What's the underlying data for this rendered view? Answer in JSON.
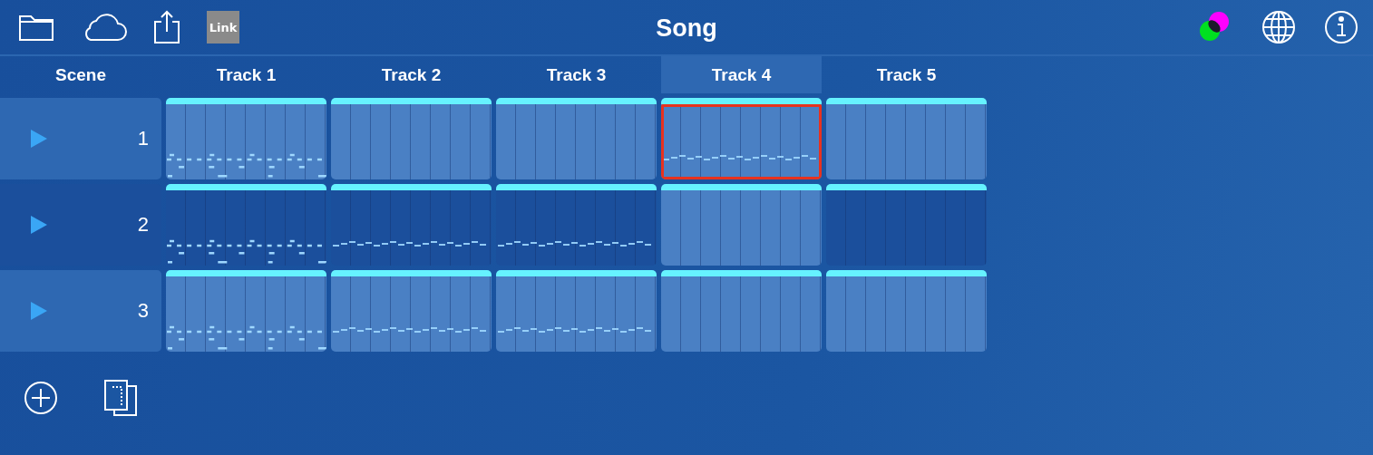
{
  "toolbar": {
    "link_label": "Link",
    "title": "Song"
  },
  "tracks": [
    {
      "label": "Track 1",
      "selected": false
    },
    {
      "label": "Track 2",
      "selected": false
    },
    {
      "label": "Track 3",
      "selected": false
    },
    {
      "label": "Track 4",
      "selected": true
    },
    {
      "label": "Track 5",
      "selected": false
    }
  ],
  "scene_header": "Scene",
  "scenes": [
    {
      "number": "1",
      "highlighted": true,
      "clips": [
        {
          "kind": "drums",
          "highlighted": true,
          "selected": false
        },
        {
          "kind": "empty",
          "highlighted": true,
          "selected": false
        },
        {
          "kind": "empty",
          "highlighted": true,
          "selected": false
        },
        {
          "kind": "melody",
          "highlighted": true,
          "selected": true
        },
        {
          "kind": "empty",
          "highlighted": true,
          "selected": false
        }
      ]
    },
    {
      "number": "2",
      "highlighted": false,
      "clips": [
        {
          "kind": "drums",
          "highlighted": false,
          "selected": false
        },
        {
          "kind": "melody",
          "highlighted": false,
          "selected": false
        },
        {
          "kind": "melody",
          "highlighted": false,
          "selected": false
        },
        {
          "kind": "empty",
          "highlighted": true,
          "selected": false
        },
        {
          "kind": "empty",
          "highlighted": false,
          "selected": false
        }
      ]
    },
    {
      "number": "3",
      "highlighted": true,
      "clips": [
        {
          "kind": "drums",
          "highlighted": true,
          "selected": false
        },
        {
          "kind": "melody",
          "highlighted": true,
          "selected": false
        },
        {
          "kind": "melody",
          "highlighted": true,
          "selected": false
        },
        {
          "kind": "empty",
          "highlighted": true,
          "selected": false
        },
        {
          "kind": "empty",
          "highlighted": true,
          "selected": false
        }
      ]
    }
  ]
}
